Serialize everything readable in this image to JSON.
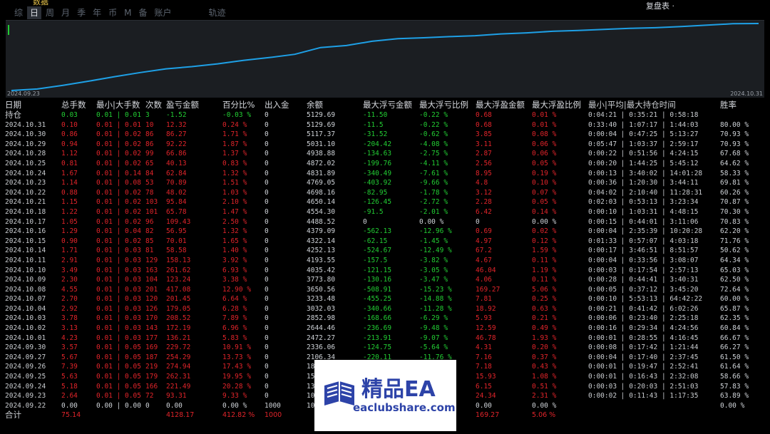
{
  "tabs": [
    {
      "label": "综"
    },
    {
      "label": "日",
      "active": true
    },
    {
      "label": "周"
    },
    {
      "label": "月"
    },
    {
      "label": "季"
    },
    {
      "label": "年"
    },
    {
      "label": "币"
    },
    {
      "label": "M"
    },
    {
      "label": "备"
    },
    {
      "label": "账户"
    },
    {
      "label": "轨迹"
    }
  ],
  "top_right_text": "复盘表 ·",
  "top_left_mark": "数据",
  "chart_data": {
    "type": "line",
    "x_start_label": "2024.09.23",
    "x_end_label": "2024.10.31",
    "x": [
      "2024.09.22",
      "2024.09.23",
      "2024.09.24",
      "2024.09.25",
      "2024.09.26",
      "2024.09.27",
      "2024.09.30",
      "2024.10.01",
      "2024.10.02",
      "2024.10.03",
      "2024.10.04",
      "2024.10.07",
      "2024.10.08",
      "2024.10.09",
      "2024.10.10",
      "2024.10.11",
      "2024.10.14",
      "2024.10.15",
      "2024.10.16",
      "2024.10.17",
      "2024.10.18",
      "2024.10.21",
      "2024.10.22",
      "2024.10.23",
      "2024.10.24",
      "2024.10.25",
      "2024.10.28",
      "2024.10.29",
      "2024.10.30",
      "2024.10.31"
    ],
    "values": [
      1000,
      1093,
      1315,
      1577,
      1851,
      2105,
      2336,
      2472,
      2644,
      2853,
      3032,
      3233,
      3651,
      3774,
      4035,
      4194,
      4252,
      4322,
      4379,
      4489,
      4554,
      4650,
      4698,
      4769,
      4832,
      4872,
      4939,
      5031,
      5117,
      5130
    ],
    "color": "#1ea0e6"
  },
  "headers": [
    "日期",
    "总手数",
    "最小|大手数",
    "次数",
    "盈亏金额",
    "百分比%",
    "出入金",
    "余额",
    "最大浮亏金额",
    "最大浮亏比例",
    "最大浮盈金额",
    "最大浮盈比例",
    "最小|平均|最大持仓时间",
    "胜率"
  ],
  "summary_row": {
    "c0": "持仓",
    "c1": "0.03",
    "c2": "0.01 | 0.01",
    "c3": "3",
    "c4": "-1.52",
    "c5": "-0.03 %",
    "c6": "0",
    "c7": "5129.69",
    "c8": "-11.50",
    "c9": "-0.22 %",
    "c10": "0.68",
    "c11": "0.01 %",
    "c12": "0:04:21 | 0:35:21 | 0:58:18",
    "c13": ""
  },
  "rows": [
    [
      "2024.10.31",
      "0.10",
      "0.01 | 0.01",
      "10",
      "12.32",
      "0.24 %",
      "0",
      "5129.69",
      "-11.5",
      "-0.22 %",
      "0.68",
      "0.01 %",
      "0:33:40 | 1:07:17 | 1:44:03",
      "80.00 %"
    ],
    [
      "2024.10.30",
      "0.86",
      "0.01 | 0.02",
      "86",
      "86.27",
      "1.71 %",
      "0",
      "5117.37",
      "-31.52",
      "-0.62 %",
      "3.85",
      "0.08 %",
      "0:00:04 | 0:47:25 | 5:13:27",
      "70.93 %"
    ],
    [
      "2024.10.29",
      "0.94",
      "0.01 | 0.02",
      "86",
      "92.22",
      "1.87 %",
      "0",
      "5031.10",
      "-204.42",
      "-4.08 %",
      "3.11",
      "0.06 %",
      "0:05:47 | 1:03:37 | 2:59:17",
      "70.93 %"
    ],
    [
      "2024.10.28",
      "1.12",
      "0.01 | 0.02",
      "99",
      "66.86",
      "1.37 %",
      "0",
      "4938.88",
      "-134.63",
      "-2.75 %",
      "2.87",
      "0.06 %",
      "0:00:22 | 0:51:56 | 4:24:15",
      "67.68 %"
    ],
    [
      "2024.10.25",
      "0.81",
      "0.01 | 0.02",
      "65",
      "40.13",
      "0.83 %",
      "0",
      "4872.02",
      "-199.76",
      "-4.11 %",
      "2.56",
      "0.05 %",
      "0:00:20 | 1:44:25 | 5:45:12",
      "64.62 %"
    ],
    [
      "2024.10.24",
      "1.67",
      "0.01 | 0.14",
      "84",
      "62.84",
      "1.32 %",
      "0",
      "4831.89",
      "-340.49",
      "-7.61 %",
      "8.95",
      "0.19 %",
      "0:00:13 | 3:40:02 | 14:01:28",
      "58.33 %"
    ],
    [
      "2024.10.23",
      "1.14",
      "0.01 | 0.08",
      "53",
      "70.89",
      "1.51 %",
      "0",
      "4769.05",
      "-403.92",
      "-9.66 %",
      "4.8",
      "0.10 %",
      "0:00:36 | 1:20:30 | 3:44:11",
      "69.81 %"
    ],
    [
      "2024.10.22",
      "0.88",
      "0.01 | 0.02",
      "78",
      "48.02",
      "1.03 %",
      "0",
      "4698.16",
      "-82.95",
      "-1.78 %",
      "3.12",
      "0.07 %",
      "0:04:02 | 2:10:40 | 11:28:31",
      "60.26 %"
    ],
    [
      "2024.10.21",
      "1.15",
      "0.01 | 0.02",
      "103",
      "95.84",
      "2.10 %",
      "0",
      "4650.14",
      "-126.45",
      "-2.72 %",
      "2.28",
      "0.05 %",
      "0:02:03 | 0:53:13 | 3:23:34",
      "70.87 %"
    ],
    [
      "2024.10.18",
      "1.22",
      "0.01 | 0.02",
      "101",
      "65.78",
      "1.47 %",
      "0",
      "4554.30",
      "-91.5",
      "-2.01 %",
      "6.42",
      "0.14 %",
      "0:00:10 | 1:03:31 | 4:48:15",
      "70.30 %"
    ],
    [
      "2024.10.17",
      "1.05",
      "0.01 | 0.02",
      "96",
      "109.43",
      "2.50 %",
      "0",
      "4488.52",
      "0",
      "0.00 %",
      "0",
      "0.00 %",
      "0:00:15 | 0:44:01 | 3:11:06",
      "70.83 %"
    ],
    [
      "2024.10.16",
      "1.29",
      "0.01 | 0.04",
      "82",
      "56.95",
      "1.32 %",
      "0",
      "4379.09",
      "-562.13",
      "-12.96 %",
      "0.69",
      "0.02 %",
      "0:00:04 | 2:35:39 | 10:20:28",
      "62.20 %"
    ],
    [
      "2024.10.15",
      "0.90",
      "0.01 | 0.02",
      "85",
      "70.01",
      "1.65 %",
      "0",
      "4322.14",
      "-62.15",
      "-1.45 %",
      "4.97",
      "0.12 %",
      "0:01:33 | 0:57:07 | 4:03:18",
      "71.76 %"
    ],
    [
      "2024.10.14",
      "1.71",
      "0.01 | 0.03",
      "81",
      "58.58",
      "1.40 %",
      "0",
      "4252.13",
      "-524.67",
      "-12.49 %",
      "67.2",
      "1.59 %",
      "0:00:17 | 3:46:51 | 8:51:57",
      "50.62 %"
    ],
    [
      "2024.10.11",
      "2.91",
      "0.01 | 0.03",
      "129",
      "158.13",
      "3.92 %",
      "0",
      "4193.55",
      "-157.5",
      "-3.82 %",
      "4.67",
      "0.11 %",
      "0:00:04 | 0:33:56 | 3:08:07",
      "64.34 %"
    ],
    [
      "2024.10.10",
      "3.49",
      "0.01 | 0.03",
      "163",
      "261.62",
      "6.93 %",
      "0",
      "4035.42",
      "-121.15",
      "-3.05 %",
      "46.04",
      "1.19 %",
      "0:00:03 | 0:17:54 | 2:57:13",
      "65.03 %"
    ],
    [
      "2024.10.09",
      "2.30",
      "0.01 | 0.03",
      "104",
      "123.24",
      "3.38 %",
      "0",
      "3773.80",
      "-130.16",
      "-3.47 %",
      "4.06",
      "0.11 %",
      "0:00:28 | 0:44:41 | 3:40:31",
      "62.50 %"
    ],
    [
      "2024.10.08",
      "4.55",
      "0.01 | 0.03",
      "201",
      "417.08",
      "12.90 %",
      "0",
      "3650.56",
      "-508.91",
      "-15.23 %",
      "169.27",
      "5.06 %",
      "0:00:05 | 0:37:12 | 3:45:20",
      "72.64 %"
    ],
    [
      "2024.10.07",
      "2.70",
      "0.01 | 0.03",
      "120",
      "201.45",
      "6.64 %",
      "0",
      "3233.48",
      "-455.25",
      "-14.88 %",
      "7.81",
      "0.25 %",
      "0:00:10 | 5:53:13 | 64:42:22",
      "60.00 %"
    ],
    [
      "2024.10.04",
      "2.92",
      "0.01 | 0.03",
      "126",
      "179.05",
      "6.28 %",
      "0",
      "3032.03",
      "-340.66",
      "-11.28 %",
      "18.92",
      "0.63 %",
      "0:00:21 | 0:41:42 | 6:02:26",
      "65.87 %"
    ],
    [
      "2024.10.03",
      "3.78",
      "0.01 | 0.03",
      "170",
      "208.52",
      "7.89 %",
      "0",
      "2852.98",
      "-168.66",
      "-6.29 %",
      "5.93",
      "0.21 %",
      "0:00:06 | 0:23:40 | 2:25:18",
      "62.35 %"
    ],
    [
      "2024.10.02",
      "3.13",
      "0.01 | 0.03",
      "143",
      "172.19",
      "6.96 %",
      "0",
      "2644.46",
      "-236.69",
      "-9.48 %",
      "12.59",
      "0.49 %",
      "0:00:16 | 0:29:34 | 4:24:56",
      "60.84 %"
    ],
    [
      "2024.10.01",
      "4.23",
      "0.01 | 0.03",
      "177",
      "136.21",
      "5.83 %",
      "0",
      "2472.27",
      "-213.91",
      "-9.07 %",
      "46.78",
      "1.93 %",
      "0:00:01 | 0:28:55 | 4:16:45",
      "66.67 %"
    ],
    [
      "2024.09.30",
      "3.57",
      "0.01 | 0.05",
      "169",
      "229.72",
      "10.91 %",
      "0",
      "2336.06",
      "-124.75",
      "-5.64 %",
      "4.31",
      "0.20 %",
      "0:00:08 | 0:17:42 | 1:21:44",
      "66.27 %"
    ],
    [
      "2024.09.27",
      "5.67",
      "0.01 | 0.05",
      "187",
      "254.29",
      "13.73 %",
      "0",
      "2106.34",
      "-220.11",
      "-11.76 %",
      "7.16",
      "0.37 %",
      "0:00:04 | 0:17:40 | 2:37:45",
      "61.50 %"
    ],
    [
      "2024.09.26",
      "7.39",
      "0.01 | 0.05",
      "219",
      "274.94",
      "17.43 %",
      "0",
      "18",
      "",
      "",
      "7.18",
      "0.43 %",
      "0:00:01 | 0:19:47 | 2:52:41",
      "61.64 %"
    ],
    [
      "2024.09.25",
      "5.63",
      "0.01 | 0.05",
      "179",
      "262.31",
      "19.95 %",
      "0",
      "15",
      "",
      "",
      "15.93",
      "1.08 %",
      "0:00:01 | 0:16:43 | 2:32:08",
      "58.66 %"
    ],
    [
      "2024.09.24",
      "5.18",
      "0.01 | 0.05",
      "166",
      "221.49",
      "20.28 %",
      "0",
      "13",
      "",
      "",
      "6.15",
      "0.51 %",
      "0:00:03 | 0:20:03 | 2:51:03",
      "57.83 %"
    ],
    [
      "2024.09.23",
      "2.64",
      "0.01 | 0.05",
      "72",
      "93.31",
      "9.33 %",
      "0",
      "10",
      "",
      "",
      "24.34",
      "2.31 %",
      "0:00:02 | 0:11:43 | 1:17:35",
      "63.89 %"
    ],
    [
      "2024.09.22",
      "0.00",
      "0.00 | 0.00",
      "0",
      "0.00",
      "0.00 %",
      "1000",
      "10",
      "",
      "",
      "0.00",
      "0.00 %",
      "",
      "0.00 %"
    ]
  ],
  "total_row": {
    "c0": "合计",
    "c1": "75.14",
    "c2": "",
    "c3": "",
    "c4": "4128.17",
    "c5": "412.82 %",
    "c6": "1000",
    "c7": "",
    "c8": "",
    "c9": "",
    "c10": "169.27",
    "c11": "5.06 %",
    "c12": "",
    "c13": ""
  },
  "watermark": {
    "title": "精品EA",
    "url": "eaclubshare.com"
  }
}
